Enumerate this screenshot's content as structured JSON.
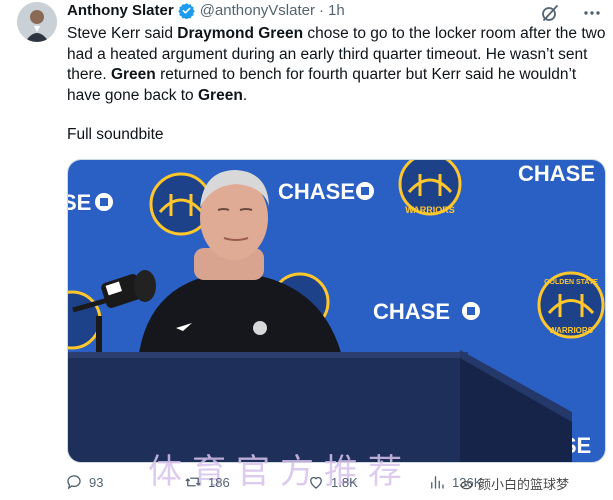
{
  "tweet": {
    "author_name": "Anthony Slater",
    "handle": "@anthonyVslater",
    "separator": "·",
    "time": "1h",
    "text_parts": {
      "p1": "Steve Kerr said ",
      "p2": "Draymond Green",
      "p3": " chose to go to the locker room after the two had a heated argument during an early third quarter timeout. He wasn’t sent there. ",
      "p4": "Green",
      "p5": " returned to bench for fourth quarter but Kerr said he wouldn’t have gone back to ",
      "p6": "Green",
      "p7": "."
    },
    "soundbite": "Full soundbite"
  },
  "media": {
    "banner_text": "CHASE",
    "banner_text_left": "SE",
    "banner_text_right": "ASE",
    "logo_top": "GOLDEN STATE",
    "logo_bottom": "WARRIORS"
  },
  "actions": {
    "replies": "93",
    "retweets": "186",
    "likes": "1.8K",
    "views": "136K"
  },
  "watermark": "体育官方推荐",
  "attribution": "颜小白的篮球梦",
  "colors": {
    "verified": "#1d9bf0",
    "backdrop": "#2a60c4",
    "podium": "#1e2f5a",
    "warriors_blue": "#1d428a",
    "warriors_gold": "#ffc72c"
  }
}
